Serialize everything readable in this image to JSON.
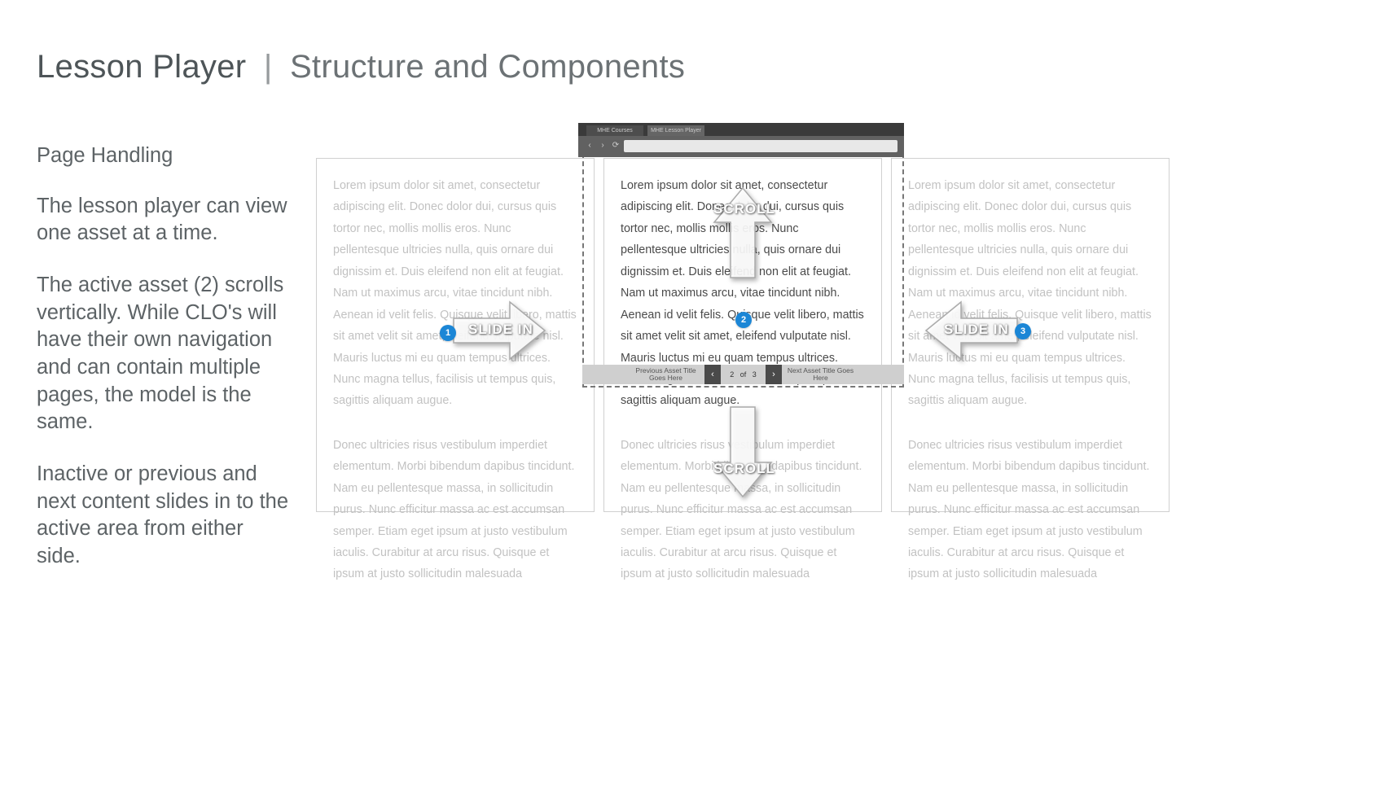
{
  "title": {
    "main": "Lesson Player",
    "separator": "|",
    "sub": "Structure and Components"
  },
  "sidebar": {
    "heading": "Page Handling",
    "para1": "The lesson player can view one asset at a time.",
    "para2": "The active asset (2) scrolls vertically. While CLO's will have their own navigation and can contain multiple pages, the model is the same.",
    "para3": "Inactive or previous and next content slides in to the active area from either side."
  },
  "browser": {
    "tab1": "MHE Courses",
    "tab2": "MHE Lesson Player",
    "back": "‹",
    "fwd": "›",
    "reload": "⟳"
  },
  "lorem": {
    "block1": "Lorem ipsum dolor sit amet, consectetur adipiscing elit. Donec dolor dui, cursus quis tortor nec, mollis mollis eros. Nunc pellentesque ultricies nulla, quis ornare dui dignissim et. Duis eleifend non elit at feugiat. Nam ut maximus arcu, vitae tincidunt nibh. Aenean id velit felis. Quisque velit libero, mattis sit amet velit sit amet, eleifend vulputate nisl. Mauris luctus mi eu quam tempus ultrices. Nunc magna tellus, facilisis ut tempus quis, sagittis aliquam augue.",
    "block2": "Donec ultricies risus vestibulum imperdiet elementum. Morbi bibendum dapibus tincidunt. Nam eu pellentesque massa, in sollicitudin purus. Nunc efficitur massa ac est accumsan semper. Etiam eget ipsum at justo vestibulum iaculis. Curabitur at arcu risus. Quisque et ipsum at justo sollicitudin malesuada"
  },
  "pager": {
    "prev_label": "Previous Asset Title Goes Here",
    "next_label": "Next Asset Title Goes Here",
    "current": "2",
    "of": "of",
    "total": "3",
    "prev_icon": "‹",
    "next_icon": "›"
  },
  "markers": {
    "m1": "1",
    "m2": "2",
    "m3": "3"
  },
  "arrows": {
    "slide_in": "SLIDE IN",
    "scroll": "SCROLL"
  }
}
